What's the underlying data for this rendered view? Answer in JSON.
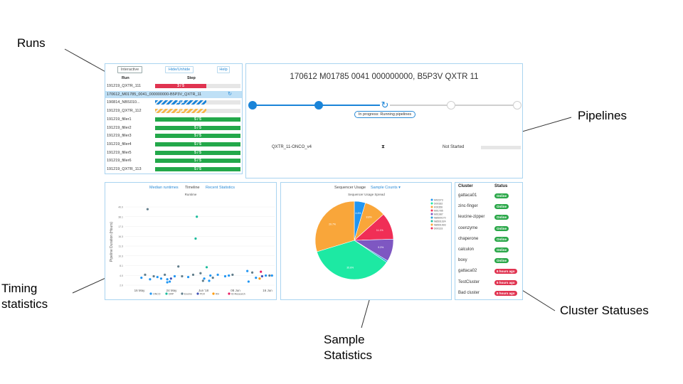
{
  "callouts": {
    "runs": "Runs",
    "pipelines": "Pipelines",
    "timing_line1": "Timing",
    "timing_line2": "statistics",
    "sample_line1": "Sample",
    "sample_line2": "Statistics",
    "cluster": "Cluster Statuses"
  },
  "runs": {
    "toolbar": {
      "interactive": "Interactive",
      "hide_unhide": "Hide/Unhide",
      "help": "Help"
    },
    "headers": {
      "run": "Run",
      "step": "Step"
    },
    "rows": [
      {
        "name": "191219_QXTR_111",
        "step": "3 / 5",
        "progress": 0.6,
        "color": "#e03350",
        "striped": false,
        "selected": false
      },
      {
        "name": "170612_M01785_0041_000000000-B5P3V_QXTR_11",
        "step": "",
        "progress": 0,
        "color": "#1a84d8",
        "striped": false,
        "selected": true
      },
      {
        "name": "190814_NBS010...",
        "step": "3 / 5",
        "progress": 0.6,
        "color": "#1a84d8",
        "striped": true,
        "selected": false
      },
      {
        "name": "191219_QXTR_112",
        "step": "3 / 5",
        "progress": 0.6,
        "color": "#f7b64a",
        "striped": true,
        "selected": false
      },
      {
        "name": "191219_filler1",
        "step": "5 / 5",
        "progress": 1,
        "color": "#23a84a",
        "striped": false,
        "selected": false
      },
      {
        "name": "191219_filler2",
        "step": "5 / 5",
        "progress": 1,
        "color": "#23a84a",
        "striped": false,
        "selected": false
      },
      {
        "name": "191219_filler3",
        "step": "5 / 5",
        "progress": 1,
        "color": "#23a84a",
        "striped": false,
        "selected": false
      },
      {
        "name": "191219_filler4",
        "step": "5 / 5",
        "progress": 1,
        "color": "#23a84a",
        "striped": false,
        "selected": false
      },
      {
        "name": "191219_filler5",
        "step": "5 / 5",
        "progress": 1,
        "color": "#23a84a",
        "striped": false,
        "selected": false
      },
      {
        "name": "191219_filler6",
        "step": "5 / 5",
        "progress": 1,
        "color": "#23a84a",
        "striped": false,
        "selected": false
      },
      {
        "name": "191219_QXTR_113",
        "step": "5 / 5",
        "progress": 1,
        "color": "#23a84a",
        "striped": false,
        "selected": false
      }
    ]
  },
  "pipelines": {
    "title": "170612 M01785 0041 000000000, B5P3V QXTR 11",
    "progress_label": "In progress: Running pipelines",
    "steps_completed": 2,
    "steps_total": 5,
    "pipeline": {
      "name": "QXTR_11-ONCO_v4",
      "icon": "hourglass-icon",
      "status": "Not Started"
    }
  },
  "timing": {
    "tabs": {
      "median": "Median runtimes",
      "timeline": "Timeline",
      "recent": "Recent Statistics"
    },
    "chart_data": {
      "type": "scatter",
      "title": "Runtime",
      "xlabel": "",
      "ylabel": "Pipeline Duration (Hours)",
      "x_ticks": [
        "16 May",
        "24 May",
        "Jun '18",
        "08 Jun",
        "16 Jun"
      ],
      "y_ticks": [
        "40.0",
        "38.1",
        "17.3",
        "16.3",
        "11.3",
        "10.3",
        "8.1",
        "4.0",
        "2.0"
      ],
      "legend": [
        "ONCO",
        "DRP",
        "Exome",
        "PDX",
        "RH",
        "ID-Research"
      ],
      "colors": {
        "ONCO": "#2196f3",
        "DRP": "#1abc9c",
        "Exome": "#607d8b",
        "PDX": "#3f51b5",
        "RH": "#ff9800",
        "ID-Research": "#e91e63"
      },
      "grid": true
    }
  },
  "sample": {
    "tabs": {
      "usage": "Sequencer Usage",
      "counts": "Sample Counts ▾"
    },
    "chart_data": {
      "type": "pie",
      "title": "Sequencer Usage Spread",
      "legend": [
        "M02373",
        "D00182",
        "K00356",
        "M01785",
        "M01987",
        "NB500170",
        "NB501024",
        "NB501993",
        "D00133"
      ],
      "slices": [
        {
          "label": "",
          "value": 4.6,
          "color": "#2196f3",
          "text": "4.6%"
        },
        {
          "label": "",
          "value": 8.8,
          "color": "#f9a63a",
          "text": "8.8%"
        },
        {
          "label": "",
          "value": 11.1,
          "color": "#f02e56",
          "text": "11.1%"
        },
        {
          "label": "",
          "value": 9.3,
          "color": "#7e57c2",
          "text": "9.3%"
        },
        {
          "label": "",
          "value": 0.7,
          "color": "#26a0da",
          "text": ""
        },
        {
          "label": "",
          "value": 35.8,
          "color": "#1de9a3",
          "text": "35.8%"
        },
        {
          "label": "",
          "value": 29.7,
          "color": "#f9a63a",
          "text": "29.7%"
        }
      ],
      "legend_colors": [
        "#2196f3",
        "#1de9a3",
        "#f9a63a",
        "#f02e56",
        "#7e57c2",
        "#26a0da",
        "#1abc9c",
        "#f9a63a",
        "#f02e56"
      ]
    }
  },
  "cluster": {
    "headers": {
      "cluster": "Cluster",
      "status": "Status"
    },
    "rows": [
      {
        "name": "gattaca01",
        "status": "Online",
        "ok": true
      },
      {
        "name": "zinc-finger",
        "status": "Online",
        "ok": true
      },
      {
        "name": "leucine-zipper",
        "status": "Online",
        "ok": true
      },
      {
        "name": "coenzyme",
        "status": "Online",
        "ok": true
      },
      {
        "name": "chaperone",
        "status": "Online",
        "ok": true
      },
      {
        "name": "calculon",
        "status": "Online",
        "ok": true
      },
      {
        "name": "boxy",
        "status": "Online",
        "ok": true
      },
      {
        "name": "gattaca02",
        "status": "6 hours ago",
        "ok": false
      },
      {
        "name": "TestCluster",
        "status": "6 hours ago",
        "ok": false
      },
      {
        "name": "Bad cluster",
        "status": "6 hours ago",
        "ok": false
      }
    ]
  }
}
